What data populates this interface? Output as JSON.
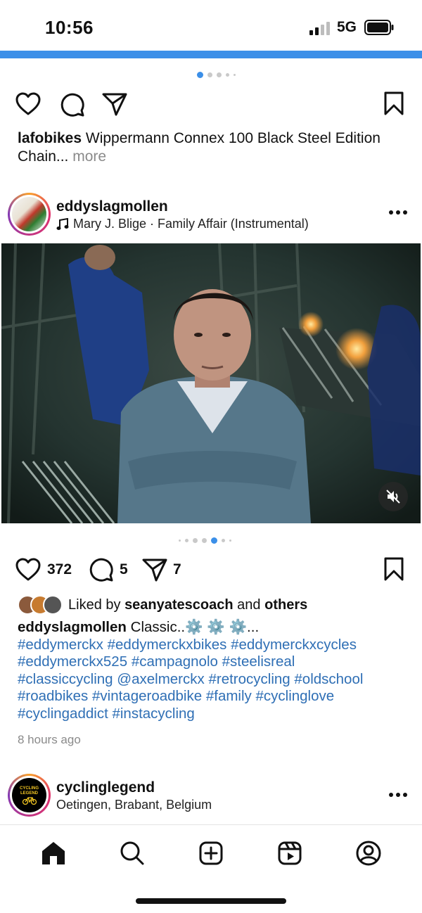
{
  "status": {
    "time": "10:56",
    "network": "5G"
  },
  "post1": {
    "username": "lafobikes",
    "caption": "Wippermann Connex 100 Black Steel Edition Chain...",
    "more_label": "more"
  },
  "post2": {
    "username": "eddyslagmollen",
    "audio": "Mary J. Blige · Family Affair (Instrumental)",
    "more_icon": "more-horizontal-icon",
    "likes": "372",
    "comments": "5",
    "shares": "7",
    "liked_by_prefix": "Liked by",
    "liked_by_user": "seanyatescoach",
    "liked_by_and": "and",
    "liked_by_others": "others",
    "caption_user": "eddyslagmollen",
    "caption_text": "Classic..⚙️ ⚙️ ⚙️...",
    "hashtags": [
      "#eddymerckx",
      "#eddymerckxbikes",
      "#eddymerckxcycles",
      "#eddymerckx525",
      "#campagnolo",
      "#steelisreal",
      "#classiccycling",
      "@axelmerckx",
      "#retrocycling",
      "#oldschool",
      "#roadbikes",
      "#vintageroadbike",
      "#family",
      "#cyclinglove",
      "#cyclingaddict",
      "#instacycling"
    ],
    "time_ago": "8 hours ago"
  },
  "post3": {
    "username": "cyclinglegend",
    "location": "Oetingen, Brabant, Belgium",
    "avatar_text_1": "CYCLING",
    "avatar_text_2": "LEGEND"
  },
  "nav": {
    "items": [
      "home-icon",
      "search-icon",
      "create-icon",
      "reels-icon",
      "profile-icon"
    ]
  },
  "colors": {
    "accent": "#3b8fe8",
    "hashtag": "#2f6fb5",
    "muted": "#8a8a8a"
  }
}
